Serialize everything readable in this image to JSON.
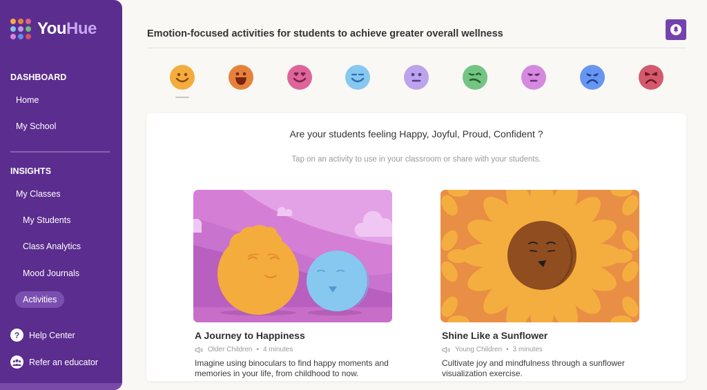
{
  "brand": {
    "name_part1": "You",
    "name_part2": "Hue",
    "logo_dot_colors": [
      "#f5a94a",
      "#e8833a",
      "#d8668f",
      "#7fc4ef",
      "#b99ae6",
      "#6cbf7a",
      "#d785d8",
      "#5b8ff0",
      "#cf5566"
    ]
  },
  "sidebar": {
    "dashboard_heading": "DASHBOARD",
    "dashboard_items": [
      {
        "label": "Home"
      },
      {
        "label": "My School"
      }
    ],
    "insights_heading": "INSIGHTS",
    "insights_items": [
      {
        "label": "My Classes"
      },
      {
        "label": "My Students"
      },
      {
        "label": "Class Analytics"
      },
      {
        "label": "Mood Journals"
      },
      {
        "label": "Activities",
        "active": true
      }
    ],
    "bottom_links": [
      {
        "label": "Help Center",
        "icon": "help-icon",
        "glyph": "?"
      },
      {
        "label": "Refer an educator",
        "icon": "group-icon"
      }
    ]
  },
  "header": {
    "title": "Emotion-focused activities for students to achieve greater overall wellness",
    "notification_icon": "bell-icon"
  },
  "emotions": [
    {
      "name": "happy",
      "color": "#f4ac3d",
      "feature": "#8a4a10",
      "selected": true
    },
    {
      "name": "joyful",
      "color": "#e5823a",
      "feature": "#7a2315"
    },
    {
      "name": "loving",
      "color": "#dd659a",
      "feature": "#7d1f4a"
    },
    {
      "name": "calm",
      "color": "#86c8f0",
      "feature": "#2f6fb0"
    },
    {
      "name": "neutral",
      "color": "#bba4ea",
      "feature": "#5c3396"
    },
    {
      "name": "uneasy",
      "color": "#74c483",
      "feature": "#24622f"
    },
    {
      "name": "tired",
      "color": "#d48ade",
      "feature": "#6b2779"
    },
    {
      "name": "sad",
      "color": "#6795f2",
      "feature": "#1f3f8a"
    },
    {
      "name": "angry",
      "color": "#d25a6c",
      "feature": "#6e1522"
    }
  ],
  "main": {
    "question": "Are your students feeling Happy, Joyful, Proud, Confident ?",
    "subtext": "Tap on an activity to use in your classroom or share with your students.",
    "activities": [
      {
        "title": "A Journey to Happiness",
        "audience": "Older Children",
        "duration": "4 minutes",
        "description": "Imagine using binoculars to find happy moments and memories in your life, from childhood to now.",
        "media_icon": "speaker-icon"
      },
      {
        "title": "Shine Like a Sunflower",
        "audience": "Young Children",
        "duration": "3 minutes",
        "description": "Cultivate joy and mindfulness through a sunflower visualization exercise.",
        "media_icon": "speaker-icon"
      }
    ]
  }
}
